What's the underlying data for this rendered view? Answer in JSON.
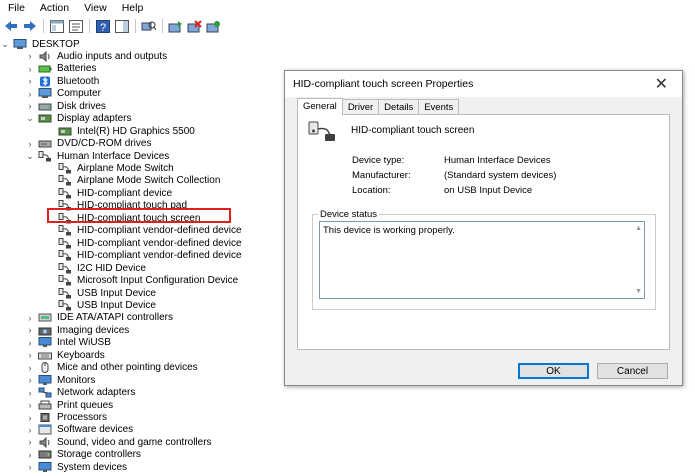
{
  "menu": [
    "File",
    "Action",
    "View",
    "Help"
  ],
  "tree": {
    "root": "DESKTOP",
    "items": [
      {
        "label": "Audio inputs and outputs",
        "level": 1,
        "expander": "›",
        "icon": "speaker-icon"
      },
      {
        "label": "Batteries",
        "level": 1,
        "expander": "›",
        "icon": "battery-icon"
      },
      {
        "label": "Bluetooth",
        "level": 1,
        "expander": "›",
        "icon": "bluetooth-icon"
      },
      {
        "label": "Computer",
        "level": 1,
        "expander": "›",
        "icon": "computer-icon"
      },
      {
        "label": "Disk drives",
        "level": 1,
        "expander": "›",
        "icon": "disk-icon"
      },
      {
        "label": "Display adapters",
        "level": 1,
        "expander": "⌄",
        "icon": "display-adapter-icon"
      },
      {
        "label": "Intel(R) HD Graphics 5500",
        "level": 2,
        "expander": "",
        "icon": "display-adapter-icon"
      },
      {
        "label": "DVD/CD-ROM drives",
        "level": 1,
        "expander": "›",
        "icon": "dvd-icon"
      },
      {
        "label": "Human Interface Devices",
        "level": 1,
        "expander": "⌄",
        "icon": "hid-icon"
      },
      {
        "label": "Airplane Mode Switch",
        "level": 2,
        "expander": "",
        "icon": "hid-icon"
      },
      {
        "label": "Airplane Mode Switch Collection",
        "level": 2,
        "expander": "",
        "icon": "hid-icon"
      },
      {
        "label": "HID-compliant device",
        "level": 2,
        "expander": "",
        "icon": "hid-icon"
      },
      {
        "label": "HID-compliant touch pad",
        "level": 2,
        "expander": "",
        "icon": "hid-icon"
      },
      {
        "label": "HID-compliant touch screen",
        "level": 2,
        "expander": "",
        "icon": "hid-icon"
      },
      {
        "label": "HID-compliant vendor-defined device",
        "level": 2,
        "expander": "",
        "icon": "hid-icon"
      },
      {
        "label": "HID-compliant vendor-defined device",
        "level": 2,
        "expander": "",
        "icon": "hid-icon"
      },
      {
        "label": "HID-compliant vendor-defined device",
        "level": 2,
        "expander": "",
        "icon": "hid-icon"
      },
      {
        "label": "I2C HID Device",
        "level": 2,
        "expander": "",
        "icon": "hid-icon"
      },
      {
        "label": "Microsoft Input Configuration Device",
        "level": 2,
        "expander": "",
        "icon": "hid-icon"
      },
      {
        "label": "USB Input Device",
        "level": 2,
        "expander": "",
        "icon": "hid-icon"
      },
      {
        "label": "USB Input Device",
        "level": 2,
        "expander": "",
        "icon": "hid-icon"
      },
      {
        "label": "IDE ATA/ATAPI controllers",
        "level": 1,
        "expander": "›",
        "icon": "ide-icon"
      },
      {
        "label": "Imaging devices",
        "level": 1,
        "expander": "›",
        "icon": "camera-icon"
      },
      {
        "label": "Intel WiUSB",
        "level": 1,
        "expander": "›",
        "icon": "monitor-icon"
      },
      {
        "label": "Keyboards",
        "level": 1,
        "expander": "›",
        "icon": "keyboard-icon"
      },
      {
        "label": "Mice and other pointing devices",
        "level": 1,
        "expander": "›",
        "icon": "mouse-icon"
      },
      {
        "label": "Monitors",
        "level": 1,
        "expander": "›",
        "icon": "monitor-icon"
      },
      {
        "label": "Network adapters",
        "level": 1,
        "expander": "›",
        "icon": "network-icon"
      },
      {
        "label": "Print queues",
        "level": 1,
        "expander": "›",
        "icon": "printer-icon"
      },
      {
        "label": "Processors",
        "level": 1,
        "expander": "›",
        "icon": "processor-icon"
      },
      {
        "label": "Software devices",
        "level": 1,
        "expander": "›",
        "icon": "software-icon"
      },
      {
        "label": "Sound, video and game controllers",
        "level": 1,
        "expander": "›",
        "icon": "speaker-icon"
      },
      {
        "label": "Storage controllers",
        "level": 1,
        "expander": "›",
        "icon": "storage-icon"
      },
      {
        "label": "System devices",
        "level": 1,
        "expander": "›",
        "icon": "monitor-icon"
      }
    ]
  },
  "dialog": {
    "title": "HID-compliant touch screen Properties",
    "close": "✕",
    "tabs": [
      "General",
      "Driver",
      "Details",
      "Events"
    ],
    "device_name": "HID-compliant touch screen",
    "props": [
      {
        "label": "Device type:",
        "value": "Human Interface Devices"
      },
      {
        "label": "Manufacturer:",
        "value": "(Standard system devices)"
      },
      {
        "label": "Location:",
        "value": "on USB Input Device"
      }
    ],
    "status_label": "Device status",
    "status_text": "This device is working properly.",
    "ok": "OK",
    "cancel": "Cancel"
  },
  "colors": {
    "highlight_border": "#e0201f",
    "accent": "#0078d7"
  }
}
